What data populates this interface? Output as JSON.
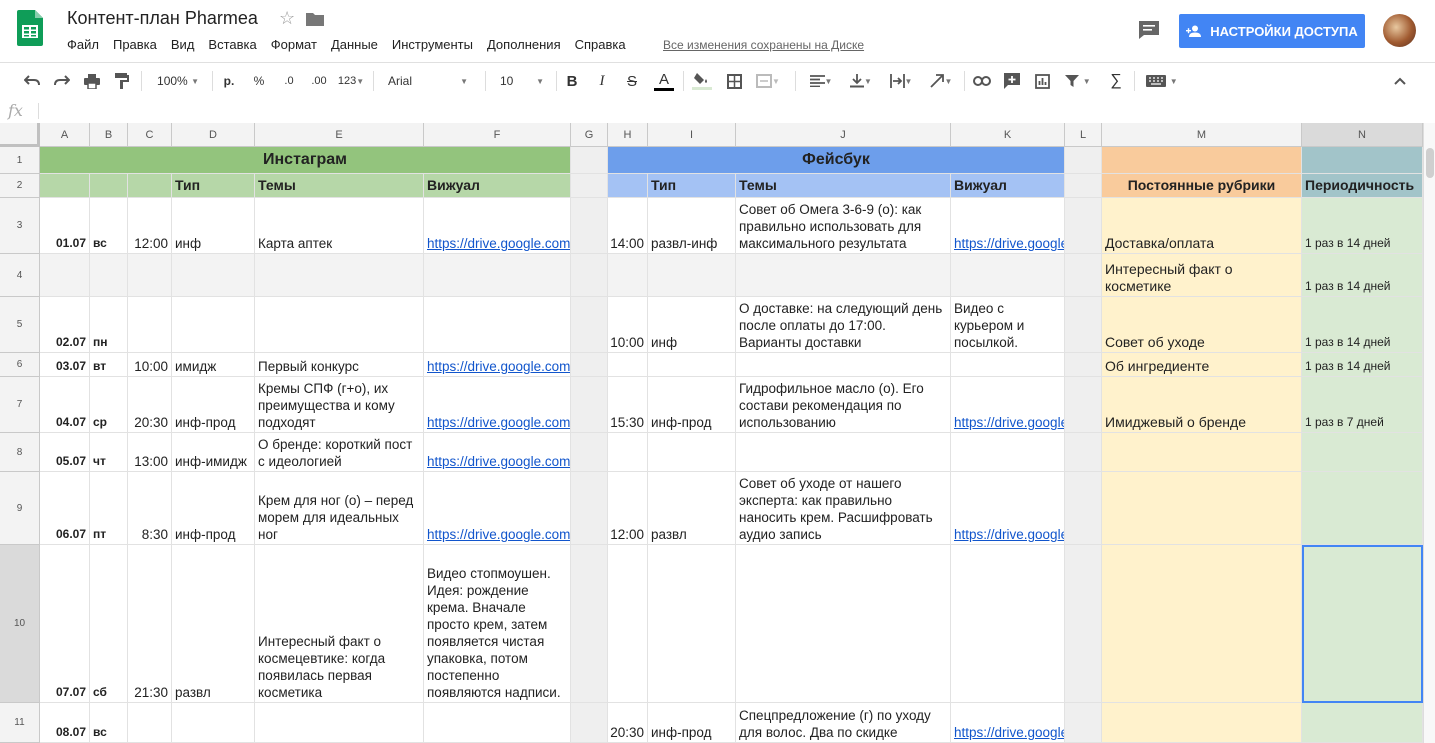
{
  "app": {
    "title": "Контент-план Pharmea",
    "menu": [
      "Файл",
      "Правка",
      "Вид",
      "Вставка",
      "Формат",
      "Данные",
      "Инструменты",
      "Дополнения",
      "Справка"
    ],
    "saved_status": "Все изменения сохранены на Диске",
    "share_label": "НАСТРОЙКИ ДОСТУПА",
    "brand_color": "#0f9d58",
    "accent_color": "#4285f4"
  },
  "toolbar": {
    "zoom": "100%",
    "currency": "р.",
    "percent": "%",
    "dec_decrease": ".0",
    "dec_increase": ".00",
    "format_more": "123",
    "font": "Arial",
    "font_size": "10",
    "bold": "B",
    "italic": "I",
    "strike": "S",
    "text_color": "A"
  },
  "formula_bar": {
    "fx": "fx",
    "value": ""
  },
  "columns": [
    "A",
    "B",
    "C",
    "D",
    "E",
    "F",
    "G",
    "H",
    "I",
    "J",
    "K",
    "L",
    "M",
    "N"
  ],
  "rows": [
    "1",
    "2",
    "3",
    "4",
    "5",
    "6",
    "7",
    "8",
    "9",
    "10",
    "11"
  ],
  "sheet": {
    "instagram_title": "Инстаграм",
    "facebook_title": "Фейсбук",
    "hdr_type_1": "Тип",
    "hdr_topics_1": "Темы",
    "hdr_visual_1": "Вижуал",
    "hdr_type_2": "Тип",
    "hdr_topics_2": "Темы",
    "hdr_visual_2": "Вижуал",
    "hdr_rubrics": "Постоянные рубрики",
    "hdr_period": "Периодичность",
    "r3": {
      "a": "01.07",
      "b": "вс",
      "c": "12:00",
      "d": "инф",
      "e": "Карта аптек",
      "f": "https://drive.google.com",
      "h": "14:00",
      "i": "развл-инф",
      "j": "Совет об Омега 3-6-9 (о): как правильно использовать для максимального результата",
      "k": "https://drive.google.com",
      "m": "Доставка/оплата",
      "n": "1 раз в 14 дней"
    },
    "r4": {
      "m": "Интересный факт о косметике",
      "n": "1 раз в 14 дней"
    },
    "r5": {
      "a": "02.07",
      "b": "пн",
      "h": "10:00",
      "i": "инф",
      "j": "О доставке: на следующий день после оплаты до 17:00. Варианты доставки",
      "k": "Видео с курьером и посылкой.",
      "m": "Совет об уходе",
      "n": "1 раз в 14 дней"
    },
    "r6": {
      "a": "03.07",
      "b": "вт",
      "c": "10:00",
      "d": "имидж",
      "e": "Первый конкурс",
      "f": "https://drive.google.com",
      "m": "Об ингредиенте",
      "n": "1 раз в 14 дней"
    },
    "r7": {
      "a": "04.07",
      "b": "ср",
      "c": "20:30",
      "d": "инф-прод",
      "e": "Кремы СПФ (г+о), их преимущества и кому подходят",
      "f": "https://drive.google.com",
      "h": "15:30",
      "i": "инф-прод",
      "j": "Гидрофильное масло (о). Его состави рекомендация по использованию",
      "k": "https://drive.google.com",
      "m": "Имиджевый о бренде",
      "n": "1 раз в 7 дней"
    },
    "r8": {
      "a": "05.07",
      "b": "чт",
      "c": "13:00",
      "d": "инф-имидж",
      "e": "О бренде: короткий пост с идеологией",
      "f": "https://drive.google.com"
    },
    "r9": {
      "a": "06.07",
      "b": "пт",
      "c": "8:30",
      "d": "инф-прод",
      "e": "Крем для ног (о) – перед морем для идеальных ног",
      "f": "https://drive.google.com",
      "h": "12:00",
      "i": "развл",
      "j": "Совет об уходе от нашего эксперта: как правильно наносить крем. Расшифровать аудио запись",
      "k": "https://drive.google.com"
    },
    "r10": {
      "a": "07.07",
      "b": "сб",
      "c": "21:30",
      "d": "развл",
      "e": "Интересный факт о космецевтике: когда появилась первая косметика",
      "f": "Видео стопмоушен. Идея: рождение крема. Вначале просто крем, затем появляется чистая упаковка, потом постепенно появляются надписи."
    },
    "r11": {
      "a": "08.07",
      "b": "вс",
      "h": "20:30",
      "i": "инф-прод",
      "j": "Спецпредложение (г) по уходу для волос. Два по скидке",
      "k": "https://drive.google.com"
    }
  },
  "colors": {
    "insta_title": "#93c47d",
    "insta_header": "#b6d7a8",
    "fb_title": "#6d9eeb",
    "fb_header": "#a4c2f4",
    "rubrics_header": "#f9cb9c",
    "rubrics_body": "#fff2cc",
    "period_header": "#a2c4c9",
    "period_body": "#d9ead3",
    "gap_col": "#efefef",
    "row4": "#f3f3f3"
  }
}
